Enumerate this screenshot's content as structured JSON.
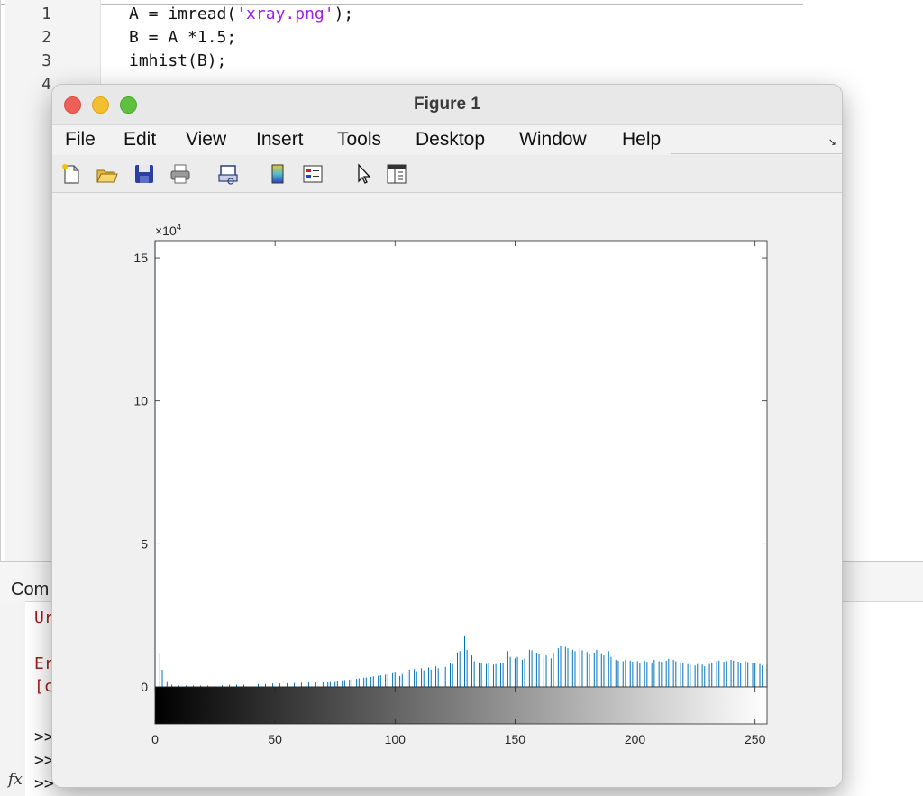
{
  "editor": {
    "line_numbers": [
      "1",
      "2",
      "3",
      "4"
    ],
    "lines": [
      {
        "pre": "A = imread(",
        "str": "'xray.png'",
        "post": ");"
      },
      {
        "pre": "B = A *1.5;",
        "str": "",
        "post": ""
      },
      {
        "pre": "imhist(B);",
        "str": "",
        "post": ""
      }
    ]
  },
  "command_window": {
    "title": "Com",
    "lines": [
      {
        "text": "Ur",
        "error": true
      },
      {
        "text": "Er",
        "error": true
      },
      {
        "text": "[c",
        "error": true
      },
      {
        "text": ">>",
        "error": false
      },
      {
        "text": ">>",
        "error": false
      },
      {
        "text": ">>",
        "error": false
      }
    ],
    "fx_label": "fx"
  },
  "figure": {
    "title": "Figure 1",
    "menu": [
      "File",
      "Edit",
      "View",
      "Insert",
      "Tools",
      "Desktop",
      "Window",
      "Help"
    ],
    "toolbar_icons": [
      "new-figure-icon",
      "open-file-icon",
      "save-icon",
      "print-icon",
      "link-plot-icon",
      "insert-colorbar-icon",
      "insert-legend-icon",
      "edit-plot-pointer-icon",
      "property-inspector-icon"
    ]
  },
  "chart_data": {
    "type": "bar",
    "exponent_label": "×10",
    "exponent_power": "4",
    "ylim": [
      0,
      15.6
    ],
    "xlim": [
      0,
      255
    ],
    "yticks": [
      0,
      5,
      10,
      15
    ],
    "xticks": [
      0,
      50,
      100,
      150,
      200,
      250
    ],
    "bar_color": "#0072bd",
    "colorbar": "gray black-to-white",
    "x": [
      0,
      2,
      3,
      5,
      7,
      10,
      13,
      16,
      19,
      22,
      25,
      28,
      31,
      34,
      37,
      40,
      43,
      46,
      49,
      52,
      55,
      58,
      61,
      64,
      67,
      70,
      72,
      73,
      75,
      76,
      78,
      79,
      81,
      82,
      84,
      85,
      87,
      88,
      90,
      91,
      93,
      94,
      96,
      97,
      99,
      100,
      102,
      103,
      105,
      106,
      108,
      109,
      111,
      112,
      114,
      115,
      117,
      118,
      120,
      121,
      123,
      124,
      126,
      127,
      129,
      130,
      132,
      133,
      135,
      136,
      138,
      139,
      141,
      142,
      144,
      145,
      147,
      148,
      150,
      151,
      153,
      154,
      156,
      157,
      159,
      160,
      162,
      163,
      165,
      166,
      168,
      169,
      171,
      172,
      174,
      175,
      177,
      178,
      180,
      181,
      183,
      184,
      186,
      187,
      189,
      190,
      192,
      193,
      195,
      196,
      198,
      199,
      201,
      202,
      204,
      205,
      207,
      208,
      210,
      211,
      213,
      214,
      216,
      217,
      219,
      220,
      222,
      223,
      225,
      226,
      228,
      229,
      231,
      232,
      234,
      235,
      237,
      238,
      240,
      241,
      243,
      244,
      246,
      247,
      249,
      250,
      252,
      253,
      255
    ],
    "values": [
      15.6,
      1.2,
      0.6,
      0.2,
      0.08,
      0.05,
      0.05,
      0.05,
      0.05,
      0.05,
      0.06,
      0.06,
      0.07,
      0.08,
      0.08,
      0.09,
      0.1,
      0.1,
      0.12,
      0.12,
      0.13,
      0.14,
      0.15,
      0.16,
      0.17,
      0.18,
      0.19,
      0.2,
      0.2,
      0.22,
      0.23,
      0.24,
      0.25,
      0.27,
      0.28,
      0.3,
      0.32,
      0.33,
      0.35,
      0.37,
      0.39,
      0.41,
      0.43,
      0.45,
      0.48,
      0.5,
      0.38,
      0.45,
      0.55,
      0.6,
      0.62,
      0.55,
      0.65,
      0.58,
      0.68,
      0.6,
      0.72,
      0.65,
      0.78,
      0.7,
      0.85,
      0.8,
      1.2,
      1.25,
      1.8,
      1.3,
      1.1,
      0.9,
      0.82,
      0.85,
      0.8,
      0.82,
      0.78,
      0.8,
      0.82,
      0.85,
      1.25,
      1.05,
      1.0,
      1.05,
      0.95,
      1.0,
      1.3,
      1.28,
      1.2,
      1.15,
      1.05,
      1.1,
      1.0,
      1.2,
      1.35,
      1.42,
      1.4,
      1.35,
      1.3,
      1.25,
      1.35,
      1.28,
      1.22,
      1.15,
      1.2,
      1.3,
      1.18,
      1.1,
      1.25,
      1.05,
      0.95,
      0.92,
      0.9,
      0.95,
      0.92,
      0.88,
      0.9,
      0.85,
      0.92,
      0.88,
      0.85,
      0.95,
      0.9,
      0.88,
      0.92,
      0.98,
      0.95,
      0.9,
      0.85,
      0.82,
      0.8,
      0.78,
      0.75,
      0.8,
      0.78,
      0.72,
      0.8,
      0.85,
      0.9,
      0.92,
      0.88,
      0.9,
      0.95,
      0.92,
      0.88,
      0.85,
      0.9,
      0.87,
      0.82,
      0.85,
      0.8,
      0.75,
      0.78,
      0.8,
      0.82,
      0.78
    ]
  }
}
